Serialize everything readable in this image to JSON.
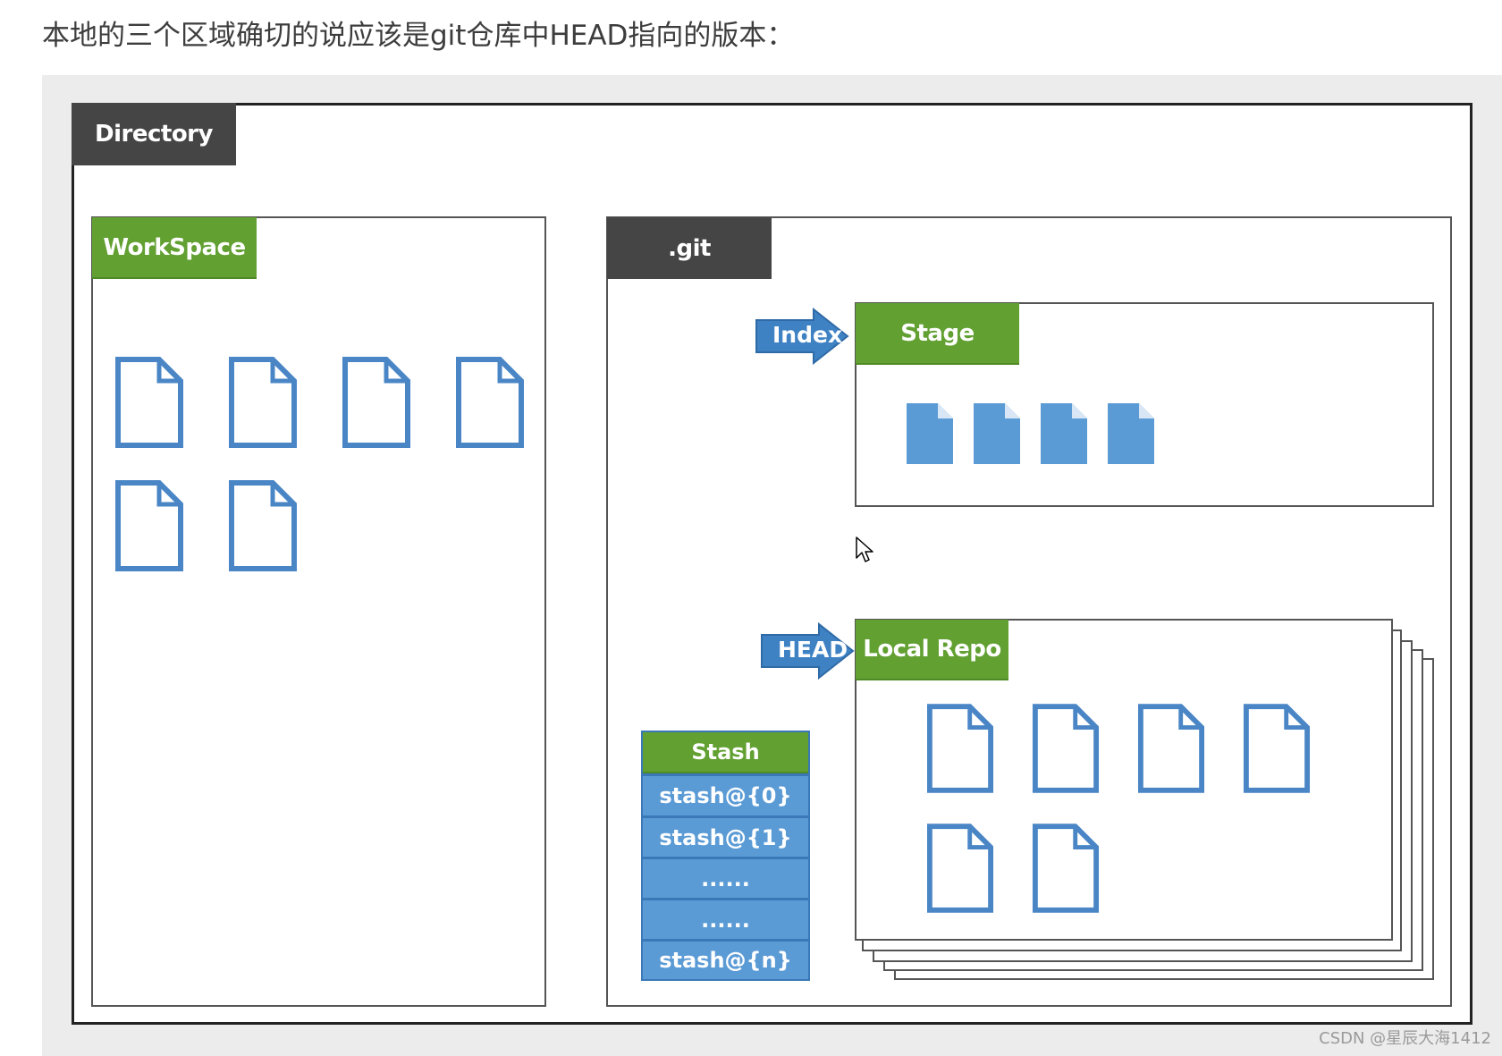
{
  "heading": "本地的三个区域确切的说应该是git仓库中HEAD指向的版本：",
  "diagram": {
    "directory_label": "Directory",
    "workspace_label": "WorkSpace",
    "git_label": ".git",
    "index_arrow_label": "Index",
    "stage_label": "Stage",
    "head_arrow_label": "HEAD",
    "local_repo_label": "Local Repo",
    "stash": {
      "header": "Stash",
      "entries": [
        "stash@{0}",
        "stash@{1}",
        "......",
        "......",
        "stash@{n}"
      ]
    },
    "workspace_file_count": 6,
    "stage_file_count": 4,
    "local_repo_file_count": 6
  },
  "watermark": "CSDN @星辰大海1412",
  "colors": {
    "green_label": "#62a032",
    "dark_label": "#454545",
    "file_blue": "#4a86c6",
    "stash_blue": "#5b9bd5"
  },
  "icons": [
    "file-outline-icon",
    "file-filled-icon",
    "arrow-right-icon",
    "mouse-pointer-icon"
  ]
}
